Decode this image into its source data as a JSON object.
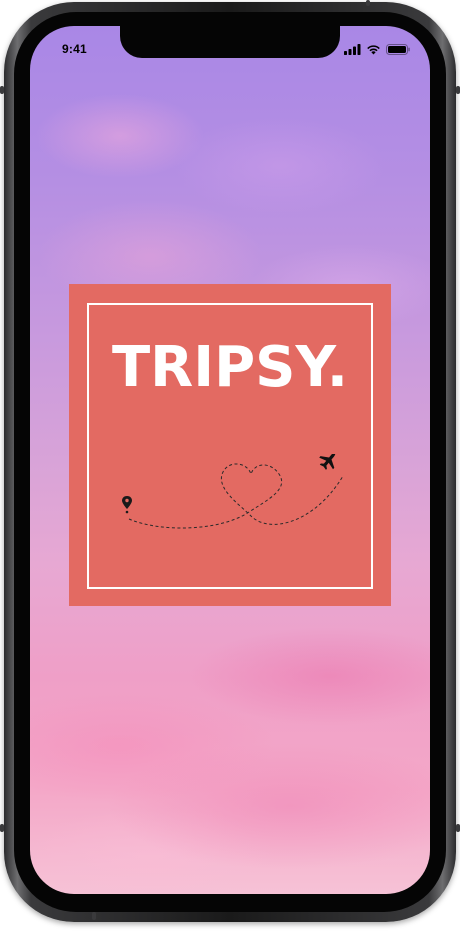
{
  "status_bar": {
    "time": "9:41",
    "icons": [
      "cellular-signal-icon",
      "wifi-icon",
      "battery-icon"
    ]
  },
  "splash": {
    "title": "TRIPSY.",
    "graphics": [
      "location-pin-icon",
      "heart-flight-path",
      "airplane-icon"
    ]
  },
  "colors": {
    "brand": "#e36a62",
    "logo_text": "#ffffff",
    "sky_top": "#a987e6",
    "sky_bottom": "#f6c2d6"
  }
}
